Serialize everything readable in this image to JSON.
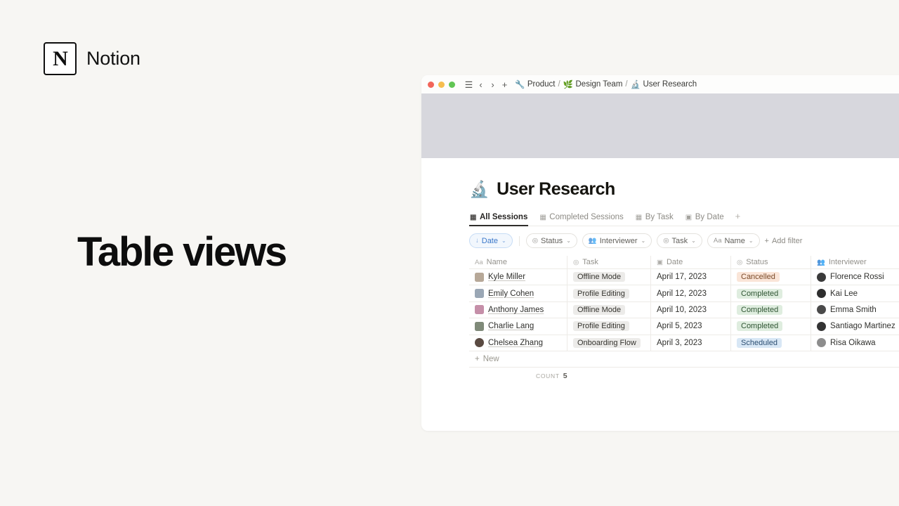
{
  "brand": {
    "name": "Notion",
    "mark_letter": "N"
  },
  "headline": "Table views",
  "window": {
    "traffic_lights": [
      "close",
      "minimize",
      "maximize"
    ],
    "toolbar_icons": [
      "menu-icon",
      "back-icon",
      "forward-icon",
      "new-page-icon"
    ],
    "breadcrumbs": [
      {
        "emoji": "🔧",
        "label": "Product",
        "separator": "/"
      },
      {
        "emoji": "🌿",
        "label": "Design Team",
        "separator": "/"
      },
      {
        "emoji": "🔬",
        "label": "User Research",
        "separator": ""
      }
    ]
  },
  "page": {
    "emoji": "🔬",
    "title": "User Research",
    "tabs": [
      {
        "label": "All Sessions",
        "icon": "table-icon",
        "active": true
      },
      {
        "label": "Completed Sessions",
        "icon": "table-icon",
        "active": false
      },
      {
        "label": "By Task",
        "icon": "table-icon",
        "active": false
      },
      {
        "label": "By Date",
        "icon": "calendar-icon",
        "active": false
      }
    ],
    "tab_add_label": "+"
  },
  "filters": {
    "sort": {
      "label": "Date",
      "icon": "arrow-down-icon",
      "caret": "⌄"
    },
    "items": [
      {
        "label": "Status",
        "icon": "select-icon",
        "caret": "⌄"
      },
      {
        "label": "Interviewer",
        "icon": "people-icon",
        "caret": "⌄"
      },
      {
        "label": "Task",
        "icon": "select-icon",
        "caret": "⌄"
      },
      {
        "label": "Name",
        "icon": "text-icon",
        "caret": "⌄"
      }
    ],
    "add_filter_label": "Add filter",
    "add_filter_icon": "plus-icon"
  },
  "table": {
    "columns": [
      {
        "label": "Name",
        "icon": "Aa"
      },
      {
        "label": "Task",
        "icon": "select-icon"
      },
      {
        "label": "Date",
        "icon": "calendar-icon"
      },
      {
        "label": "Status",
        "icon": "select-icon"
      },
      {
        "label": "Interviewer",
        "icon": "people-icon"
      }
    ],
    "rows": [
      {
        "name": "Kyle Miller",
        "task": "Offline Mode",
        "date": "April 17, 2023",
        "status": "Cancelled",
        "status_kind": "cancelled",
        "interviewer": "Florence Rossi",
        "avatar": "#b7a898",
        "interviewer_avatar": "#3a3a3a"
      },
      {
        "name": "Emily Cohen",
        "task": "Profile Editing",
        "date": "April 12, 2023",
        "status": "Completed",
        "status_kind": "completed",
        "interviewer": "Kai Lee",
        "avatar": "#9aa7b5",
        "interviewer_avatar": "#2e2e2e"
      },
      {
        "name": "Anthony James",
        "task": "Offline Mode",
        "date": "April 10, 2023",
        "status": "Completed",
        "status_kind": "completed",
        "interviewer": "Emma Smith",
        "avatar": "#c58fa8",
        "interviewer_avatar": "#4a4a4a"
      },
      {
        "name": "Charlie Lang",
        "task": "Profile Editing",
        "date": "April 5, 2023",
        "status": "Completed",
        "status_kind": "completed",
        "interviewer": "Santiago Martinez",
        "avatar": "#7f8a79",
        "interviewer_avatar": "#333333"
      },
      {
        "name": "Chelsea Zhang",
        "task": "Onboarding Flow",
        "date": "April 3, 2023",
        "status": "Scheduled",
        "status_kind": "scheduled",
        "interviewer": "Risa Oikawa",
        "avatar": "#5a4a42",
        "interviewer_avatar": "#8d8d8d"
      }
    ],
    "new_row_label": "New",
    "new_row_icon": "plus-icon",
    "count_label": "COUNT",
    "count_value": "5"
  },
  "colors": {
    "page_bg": "#f7f6f3",
    "banner": "#d7d7dd",
    "accent_blue": "#3a77c9",
    "cancelled_bg": "#fae5d8",
    "completed_bg": "#dfeddf",
    "scheduled_bg": "#d8e7f5"
  }
}
